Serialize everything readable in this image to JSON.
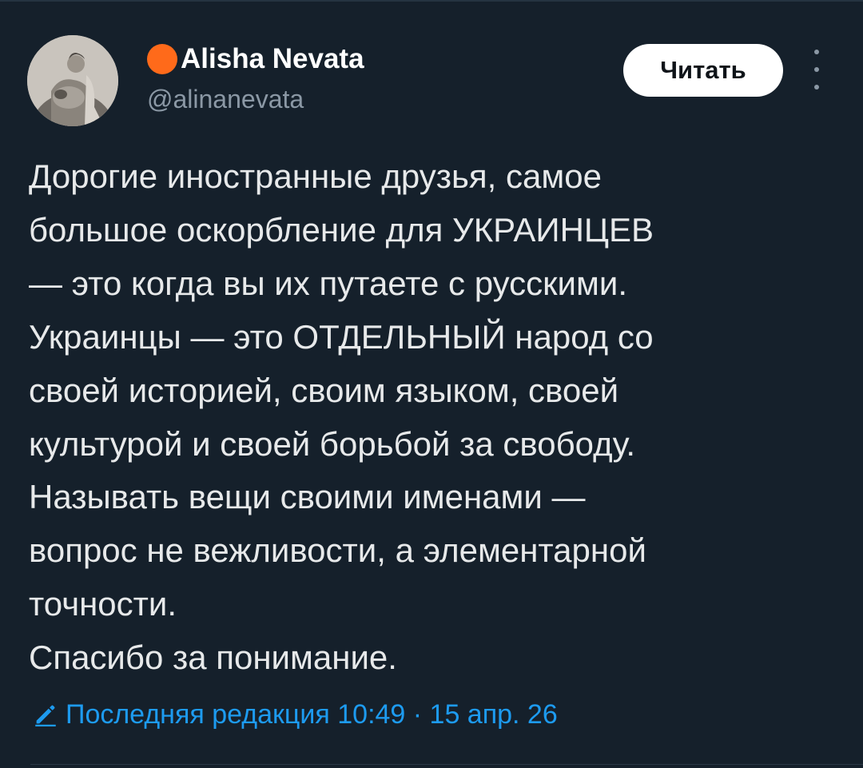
{
  "author": {
    "display_name": "Alisha Nevata",
    "handle": "@alinanevata",
    "name_prefix_icon": "orange-circle-emoji",
    "avatar_icon": "profile-photo"
  },
  "actions": {
    "follow_label": "Читать",
    "more_icon": "more-vertical-icon"
  },
  "tweet": {
    "lines": [
      "Дорогие иностранные друзья, самое",
      "большое оскорбление для УКРАИНЦЕВ",
      "— это когда вы их путаете с русскими.",
      "Украинцы — это ОТДЕЛЬНЫЙ народ со",
      "своей историей, своим языком, своей",
      "культурой и своей борьбой за свободу.",
      "Называть вещи своими именами —",
      "вопрос не вежливости, а элементарной",
      "точности.",
      "Спасибо за понимание."
    ]
  },
  "edit_info": {
    "icon": "pencil-icon",
    "text": "Последняя редакция 10:49 · 15 апр. 26"
  },
  "colors": {
    "background": "#15202b",
    "text": "#e7e9ea",
    "secondary": "#8b98a5",
    "accent": "#1d9bf0",
    "orange": "#ff6a1a"
  }
}
